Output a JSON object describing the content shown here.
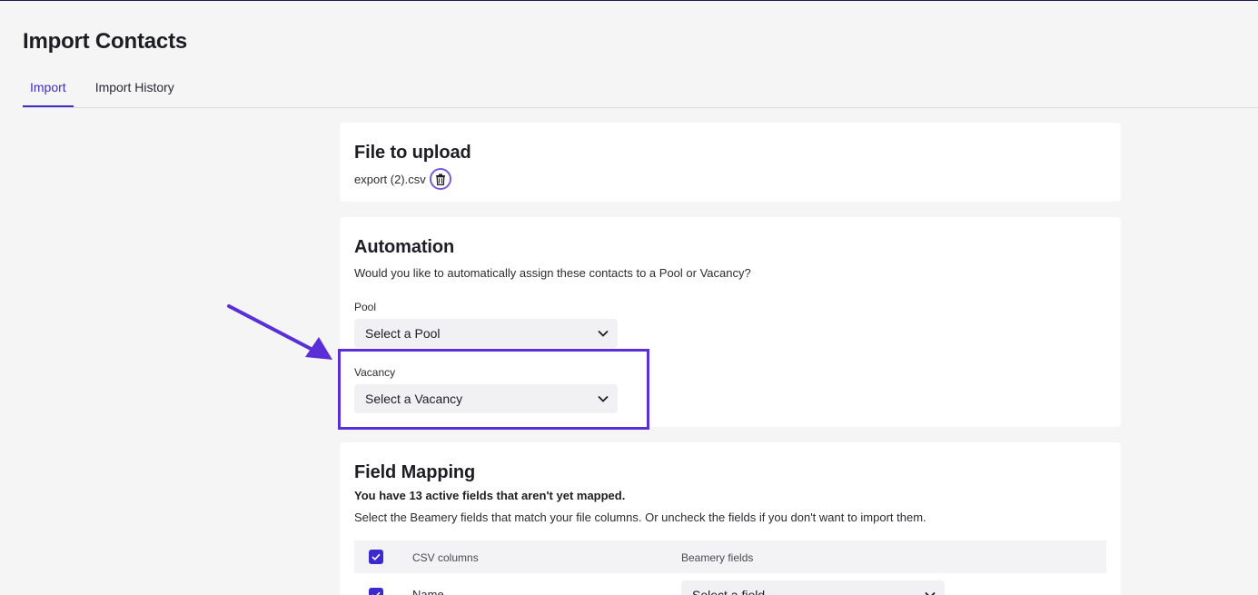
{
  "page": {
    "title": "Import Contacts"
  },
  "tabs": [
    {
      "label": "Import",
      "active": true
    },
    {
      "label": "Import History",
      "active": false
    }
  ],
  "upload": {
    "title": "File to upload",
    "filename": "export (2).csv",
    "delete_icon": "trash-icon"
  },
  "automation": {
    "title": "Automation",
    "description": "Would you like to automatically assign these contacts to a Pool or Vacancy?",
    "pool_label": "Pool",
    "pool_placeholder": "Select a Pool",
    "vacancy_label": "Vacancy",
    "vacancy_placeholder": "Select a Vacancy"
  },
  "mapping": {
    "title": "Field Mapping",
    "summary": "You have 13 active fields that aren't yet mapped.",
    "description": "Select the Beamery fields that match your file columns. Or uncheck the fields if you don't want to import them.",
    "columns": [
      "CSV columns",
      "Beamery fields"
    ],
    "rows": [
      {
        "csv": "Name",
        "field_placeholder": "Select a field",
        "checked": true
      }
    ]
  },
  "colors": {
    "accent": "#3e2fc6",
    "highlight": "#5a2fd8",
    "checkbox": "#3a2ad0"
  }
}
